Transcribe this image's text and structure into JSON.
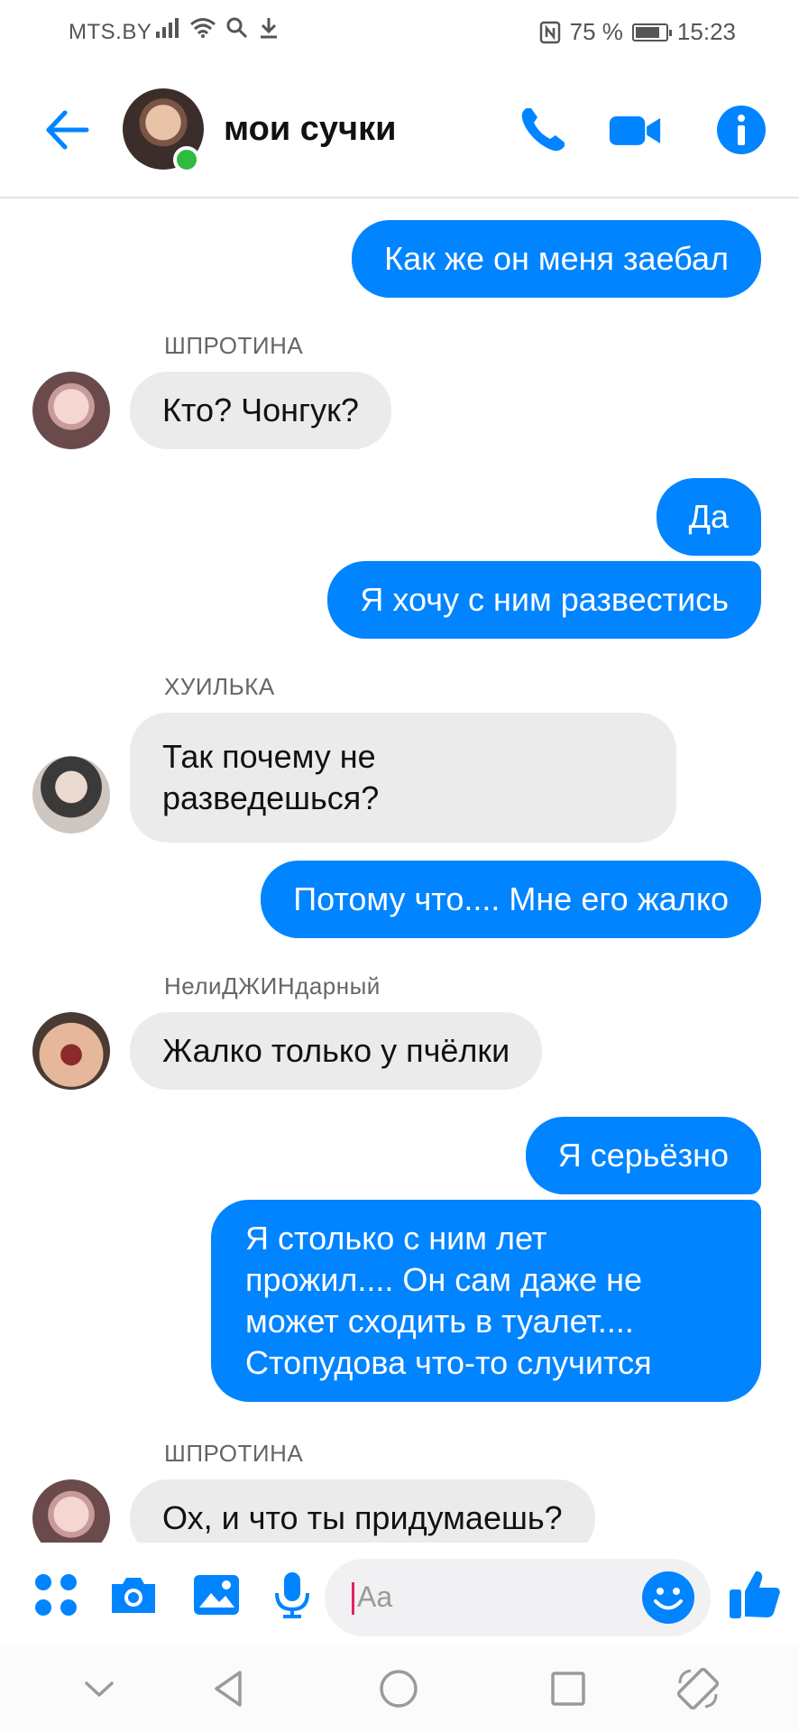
{
  "status_bar": {
    "carrier": "MTS.BY",
    "battery": "75 %",
    "time": "15:23"
  },
  "header": {
    "title": "мои сучки",
    "online": true
  },
  "colors": {
    "accent": "#0084ff",
    "incoming_bubble": "#ebebeb",
    "online": "#2ebb3e"
  },
  "messages": [
    {
      "dir": "out",
      "text": "Как же он меня заебал"
    },
    {
      "dir": "in",
      "sender": "ШПРОТИНА",
      "text": "Кто? Чонгук?"
    },
    {
      "dir": "out",
      "text": "Да"
    },
    {
      "dir": "out",
      "text": "Я хочу с ним развестись"
    },
    {
      "dir": "in",
      "sender": "ХУИЛЬКА",
      "text_lines": [
        "Так почему не",
        "разведешься?"
      ]
    },
    {
      "dir": "out",
      "text": "Потому что.... Мне его жалко"
    },
    {
      "dir": "in",
      "sender": "НелиДЖИНдарный",
      "text": "Жалко только у пчёлки"
    },
    {
      "dir": "out",
      "text": "Я серьёзно"
    },
    {
      "dir": "out",
      "text_lines": [
        "Я столько с ним лет",
        "прожил.... Он сам даже не",
        "может сходить в туалет....",
        "Стопудова что-то случится"
      ]
    },
    {
      "dir": "in",
      "sender": "ШПРОТИНА",
      "text": "Ох, и что ты придумаешь?"
    }
  ],
  "composer": {
    "placeholder": "Aa"
  },
  "icons": {
    "back": "arrow-left-icon",
    "call": "phone-icon",
    "video": "video-camera-icon",
    "info": "info-icon",
    "more": "grid-dots-icon",
    "camera": "camera-icon",
    "gallery": "image-icon",
    "mic": "microphone-icon",
    "emoji": "smiley-icon",
    "like": "thumbs-up-icon"
  }
}
